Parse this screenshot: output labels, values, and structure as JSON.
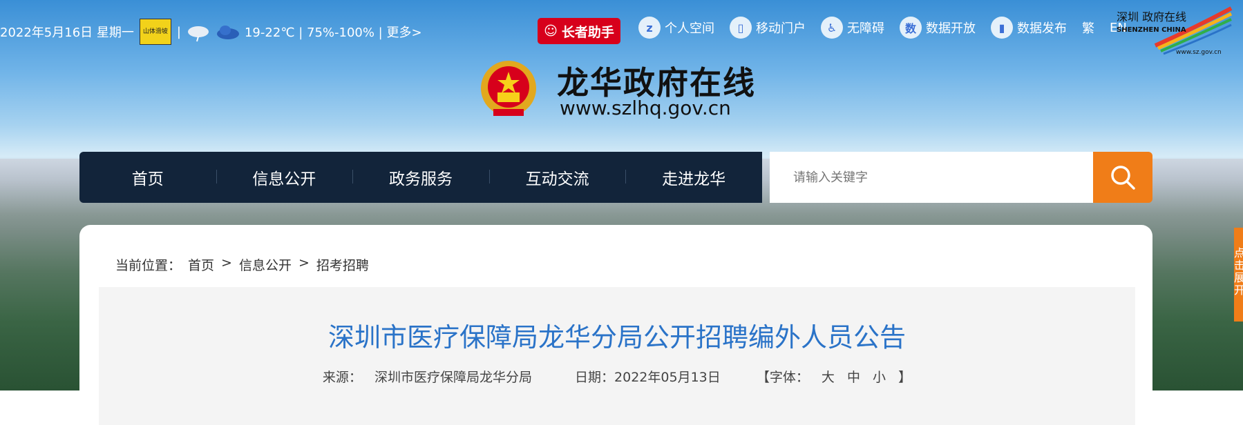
{
  "topbar": {
    "date": "2022年5月16日 星期一",
    "warning_badge": "山体滑坡",
    "separator": "|",
    "weather_text": "19-22℃ | 75%-100% | 更多>",
    "elder_label": "长者助手",
    "links": [
      {
        "label": "个人空间",
        "icon": "z"
      },
      {
        "label": "移动门户",
        "icon": "▯"
      },
      {
        "label": "无障碍",
        "icon": "♿"
      },
      {
        "label": "数据开放",
        "icon": "数"
      },
      {
        "label": "数据发布",
        "icon": "▮"
      },
      {
        "label": "繁",
        "icon": ""
      },
      {
        "label": "EN",
        "icon": ""
      }
    ],
    "sz_logo_text": "深圳 政府在线",
    "sz_logo_sub": "SHENZHEN CHINA",
    "sz_logo_url": "www.sz.gov.cn"
  },
  "header": {
    "title": "龙华政府在线",
    "url": "www.szlhq.gov.cn"
  },
  "nav": {
    "items": [
      "首页",
      "信息公开",
      "政务服务",
      "互动交流",
      "走进龙华"
    ]
  },
  "search": {
    "placeholder": "请输入关键字"
  },
  "breadcrumb": {
    "prefix": "当前位置：",
    "items": [
      "首页",
      ">",
      "信息公开",
      ">",
      "招考招聘"
    ]
  },
  "article": {
    "title": "深圳市医疗保障局龙华分局公开招聘编外人员公告",
    "source_label": "来源：",
    "source": "深圳市医疗保障局龙华分局",
    "date_label": "日期：",
    "date": "2022年05月13日",
    "font_label": "【字体：",
    "font_sizes": [
      "大",
      "中",
      "小"
    ],
    "font_close": "】"
  },
  "side_tab": {
    "label": "点击展开"
  },
  "colors": {
    "nav_bg": "#12243a",
    "accent_orange": "#f07d18",
    "title_blue": "#2a73c8",
    "elder_red": "#d7001b"
  }
}
